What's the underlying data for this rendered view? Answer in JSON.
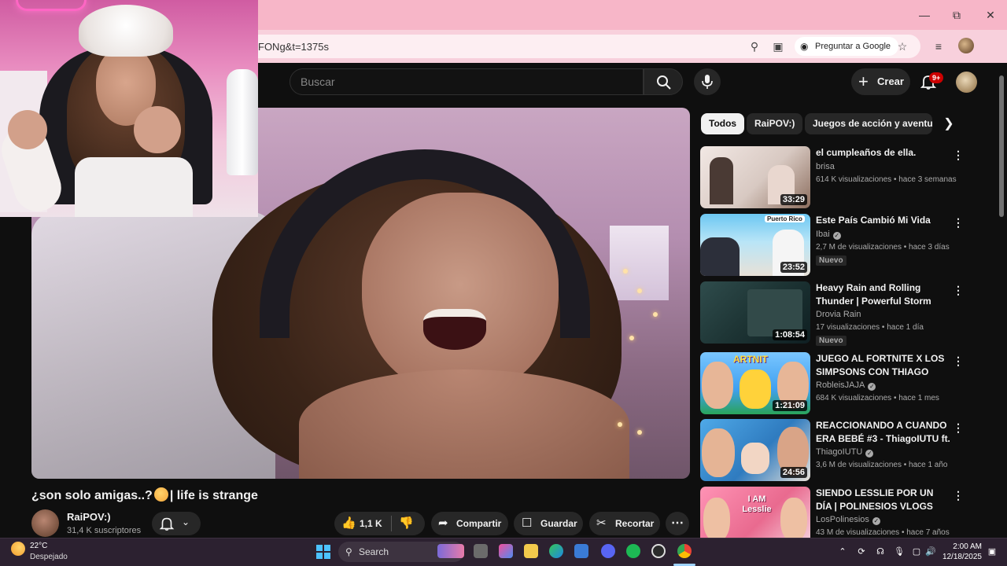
{
  "browser": {
    "url": "FONg&t=1375s",
    "ask_google": "Preguntar a Google"
  },
  "header": {
    "search_placeholder": "Buscar",
    "create_label": "Crear",
    "notifications_count": "9+"
  },
  "video": {
    "title_part1": "¿son solo amigas..?",
    "title_part2": "| life is strange",
    "channel_name": "RaiPOV:)",
    "subscribers": "31,4 K suscriptores",
    "likes": "1,1 K",
    "share_label": "Compartir",
    "save_label": "Guardar",
    "clip_label": "Recortar"
  },
  "chips": [
    {
      "label": "Todos",
      "active": true
    },
    {
      "label": "RaiPOV:)",
      "active": false
    },
    {
      "label": "Juegos de acción y aventura",
      "active": false
    }
  ],
  "recommendations": [
    {
      "title": "el cumpleaños de ella.",
      "channel": "brisa",
      "verified": false,
      "meta": "614 K visualizaciones • hace 3 semanas",
      "duration": "33:29",
      "badge": ""
    },
    {
      "title": "Este País Cambió Mi Vida",
      "channel": "Ibai",
      "verified": true,
      "meta": "2,7 M de visualizaciones • hace 3 días",
      "duration": "23:52",
      "badge": "Nuevo",
      "thumb_label": "Puerto Rico"
    },
    {
      "title": "Heavy Rain and Rolling Thunder | Powerful Storm Ambience ...",
      "channel": "Drovia Rain",
      "verified": false,
      "meta": "17 visualizaciones • hace 1 día",
      "duration": "1:08:54",
      "badge": "Nuevo"
    },
    {
      "title": "JUEGO AL FORTNITE X LOS SIMPSONS CON THIAGO",
      "channel": "RobleisJAJA",
      "verified": true,
      "meta": "684 K visualizaciones • hace 1 mes",
      "duration": "1:21:09",
      "badge": "",
      "thumb_label": "ARTNIT"
    },
    {
      "title": "REACCIONANDO A CUANDO ERA BEBÉ #3 - ThiagoIUTU ft. ...",
      "channel": "ThiagoIUTU",
      "verified": true,
      "meta": "3,6 M de visualizaciones • hace 1 año",
      "duration": "24:56",
      "badge": ""
    },
    {
      "title": "SIENDO LESSLIE POR UN DÍA | POLINESIOS VLOGS",
      "channel": "LosPolinesios",
      "verified": true,
      "meta": "43 M de visualizaciones • hace 7 años",
      "duration": "",
      "badge": "",
      "thumb_label": "I AM Lesslie"
    }
  ],
  "taskbar": {
    "temperature": "22°C",
    "weather": "Despejado",
    "search_label": "Search",
    "time": "2:00 AM",
    "date": "12/18/2025"
  },
  "colors": {
    "yt_background": "#0f0f0f",
    "chrome_titlebar": "#f7b6c8",
    "chrome_toolbar": "#f8d0dc",
    "accent_red": "#cc0000"
  },
  "icons": [
    "close-icon",
    "maximize-icon",
    "minimize-icon",
    "zoom-icon",
    "install-icon",
    "lens-icon",
    "star-icon",
    "reading-list-icon",
    "search-icon",
    "mic-icon",
    "plus-icon",
    "bell-icon",
    "like-icon",
    "dislike-icon",
    "share-icon",
    "save-icon",
    "scissors-icon",
    "more-icon",
    "chevron-right-icon",
    "chevron-down-icon",
    "kebab-icon",
    "verified-icon",
    "windows-start-icon"
  ]
}
